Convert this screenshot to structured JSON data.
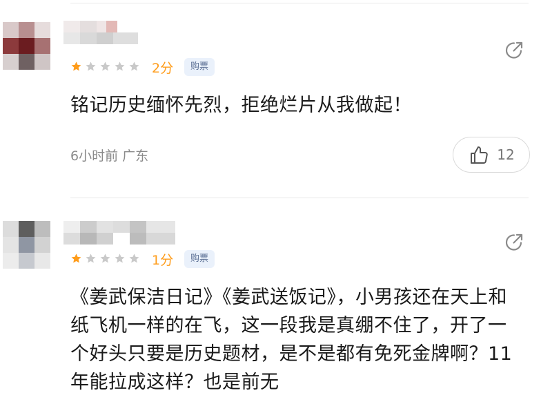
{
  "comments": [
    {
      "rating_stars": 1,
      "score_label": "2分",
      "badge": "购票",
      "text": "铭记历史缅怀先烈，拒绝烂片从我做起！",
      "time_location": "6小时前 广东",
      "like_count": "12"
    },
    {
      "rating_stars": 1,
      "score_label": "1分",
      "badge": "购票",
      "text": "《姜武保洁日记》《姜武送饭记》，小男孩还在天上和纸飞机一样的在飞，这一段我是真绷不住了，开了一个好头只要是历史题材，是不是都有免死金牌啊？11年能拉成这样？也是前无"
    }
  ],
  "colors": {
    "star_active": "#ff9c1a",
    "star_inactive": "#c9c9c9",
    "badge_bg": "#eaf1fb",
    "badge_text": "#5b6f94"
  },
  "icons": {
    "share": "share-icon",
    "like": "thumbs-up-icon",
    "star": "star-icon"
  }
}
